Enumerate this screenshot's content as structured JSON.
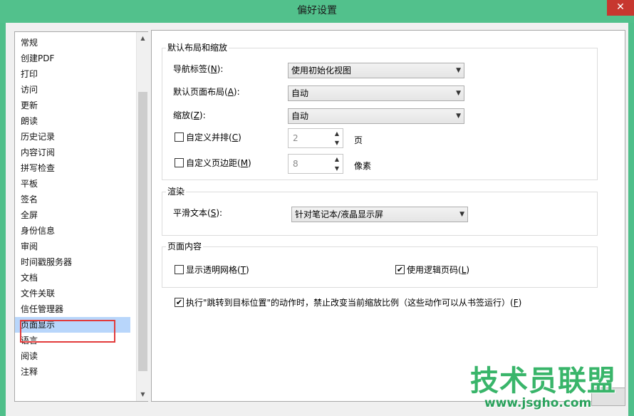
{
  "window": {
    "title": "偏好设置",
    "close_glyph": "✕"
  },
  "sidebar": {
    "items": [
      {
        "label": "常规"
      },
      {
        "label": "创建PDF"
      },
      {
        "label": "打印"
      },
      {
        "label": "访问"
      },
      {
        "label": "更新"
      },
      {
        "label": "朗读"
      },
      {
        "label": "历史记录"
      },
      {
        "label": "内容订阅"
      },
      {
        "label": "拼写检查"
      },
      {
        "label": "平板"
      },
      {
        "label": "签名"
      },
      {
        "label": "全屏"
      },
      {
        "label": "身份信息"
      },
      {
        "label": "审阅"
      },
      {
        "label": "时间戳服务器"
      },
      {
        "label": "文档"
      },
      {
        "label": "文件关联"
      },
      {
        "label": "信任管理器"
      },
      {
        "label": "页面显示",
        "selected": true
      },
      {
        "label": "语言"
      },
      {
        "label": "阅读"
      },
      {
        "label": "注释"
      }
    ],
    "scroll_up_icon": "▲",
    "scroll_down_icon": "▼"
  },
  "layout_group": {
    "title": "默认布局和缩放",
    "nav_tab": {
      "label": "导航标签(",
      "key": "N",
      "suffix": "):",
      "value": "使用初始化视图"
    },
    "page_layout": {
      "label": "默认页面布局(",
      "key": "A",
      "suffix": "):",
      "value": "自动"
    },
    "zoom": {
      "label": "缩放(",
      "key": "Z",
      "suffix": "):",
      "value": "自动"
    },
    "custom_columns": {
      "label": "自定义并排(",
      "key": "C",
      "suffix": ")",
      "checked": false,
      "value": "2",
      "unit": "页"
    },
    "custom_margin": {
      "label": "自定义页边距(",
      "key": "M",
      "suffix": ")",
      "checked": false,
      "value": "8",
      "unit": "像素"
    }
  },
  "render_group": {
    "title": "渲染",
    "smooth_text": {
      "label": "平滑文本(",
      "key": "S",
      "suffix": "):",
      "value": "针对笔记本/液晶显示屏"
    }
  },
  "content_group": {
    "title": "页面内容",
    "transparency_grid": {
      "label": "显示透明网格(",
      "key": "T",
      "suffix": ")",
      "checked": false
    },
    "logical_page": {
      "label": "使用逻辑页码(",
      "key": "L",
      "suffix": ")",
      "checked": true
    }
  },
  "goto_option": {
    "label": "执行\"跳转到目标位置\"的动作时，禁止改变当前缩放比例（这些动作可以从书签运行）(",
    "key": "F",
    "suffix": ")",
    "checked": true
  },
  "icons": {
    "combo_caret": "▼",
    "spin_up": "▲",
    "spin_down": "▼",
    "check_mark": "✔"
  },
  "watermark": {
    "title": "技术员联盟",
    "url": "www.jsgho.com"
  },
  "colors": {
    "titlebar": "#52c18c",
    "selection": "#b8d6fb",
    "highlight_outline": "#e23b3b",
    "close_button": "#c7372f"
  }
}
